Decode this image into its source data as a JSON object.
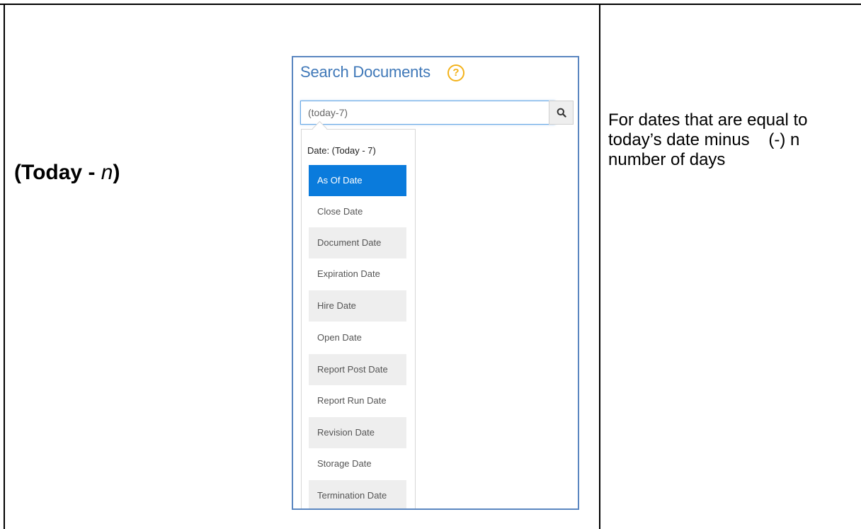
{
  "table": {
    "left_cell": {
      "label_bold": "(Today - ",
      "label_italic": "n",
      "label_close": ")"
    },
    "right_cell": {
      "line1": "For dates that are equal to",
      "line2": "today’s date minus    (-) n",
      "line3": "number of days"
    }
  },
  "panel": {
    "title": "Search Documents",
    "help_icon": "question-circle-icon",
    "search": {
      "value": "(today-7)",
      "button_icon": "search-icon"
    },
    "dropdown": {
      "header": "Date: (Today - 7)",
      "items": [
        {
          "label": "As Of Date"
        },
        {
          "label": "Close Date"
        },
        {
          "label": "Document Date"
        },
        {
          "label": "Expiration Date"
        },
        {
          "label": "Hire Date"
        },
        {
          "label": "Open Date"
        },
        {
          "label": "Report Post Date"
        },
        {
          "label": "Report Run Date"
        },
        {
          "label": "Revision Date"
        },
        {
          "label": "Storage Date"
        },
        {
          "label": "Termination Date"
        }
      ],
      "active_item": "As Of Date"
    }
  },
  "colors": {
    "panel_border": "#5a86c0",
    "title": "#3f78b8",
    "help_icon": "#f3b21a",
    "active_item_bg": "#0a7bdc",
    "alt_row_bg": "#eeeeee"
  }
}
